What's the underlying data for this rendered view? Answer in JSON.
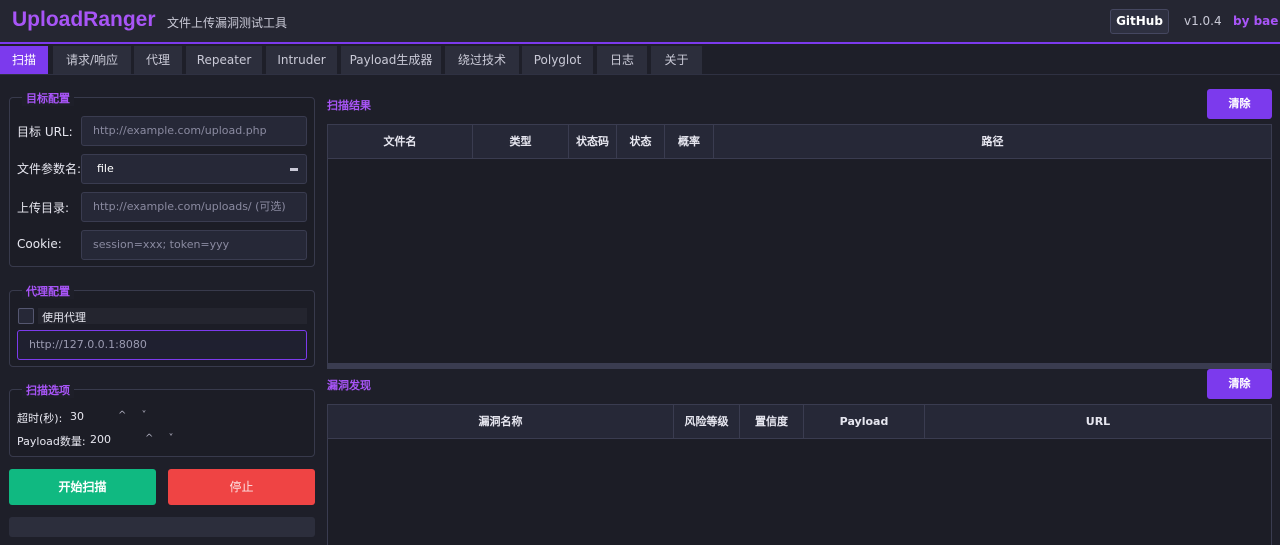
{
  "header": {
    "logo": "UploadRanger",
    "subtitle": "文件上传漏洞测试工具",
    "github_label": "GitHub",
    "version": "v1.0.4",
    "author": "by bae"
  },
  "tabs": [
    {
      "label": "扫描",
      "active": true
    },
    {
      "label": "请求/响应"
    },
    {
      "label": "代理"
    },
    {
      "label": "Repeater"
    },
    {
      "label": "Intruder"
    },
    {
      "label": "Payload生成器"
    },
    {
      "label": "绕过技术"
    },
    {
      "label": "Polyglot"
    },
    {
      "label": "日志"
    },
    {
      "label": "关于"
    }
  ],
  "target": {
    "title": "目标配置",
    "url_label": "目标 URL:",
    "url_placeholder": "http://example.com/upload.php",
    "param_label": "文件参数名:",
    "param_value": "file",
    "dir_label": "上传目录:",
    "dir_placeholder": "http://example.com/uploads/ (可选)",
    "cookie_label": "Cookie:",
    "cookie_placeholder": "session=xxx; token=yyy"
  },
  "proxy": {
    "title": "代理配置",
    "use_label": "使用代理",
    "address": "http://127.0.0.1:8080"
  },
  "options": {
    "title": "扫描选项",
    "timeout_label": "超时(秒):",
    "timeout_value": "30",
    "payload_label": "Payload数量:",
    "payload_value": "200",
    "spin_arrows": "^ ˅"
  },
  "actions": {
    "start": "开始扫描",
    "stop": "停止"
  },
  "results": {
    "title": "扫描结果",
    "clear": "清除",
    "columns": [
      "文件名",
      "类型",
      "状态码",
      "状态",
      "概率",
      "路径"
    ]
  },
  "vulns": {
    "title": "漏洞发现",
    "clear": "清除",
    "columns": [
      "漏洞名称",
      "风险等级",
      "置信度",
      "Payload",
      "URL"
    ]
  },
  "colors": {
    "accent": "#7c3aed",
    "start": "#10b981",
    "stop": "#ef4444"
  }
}
